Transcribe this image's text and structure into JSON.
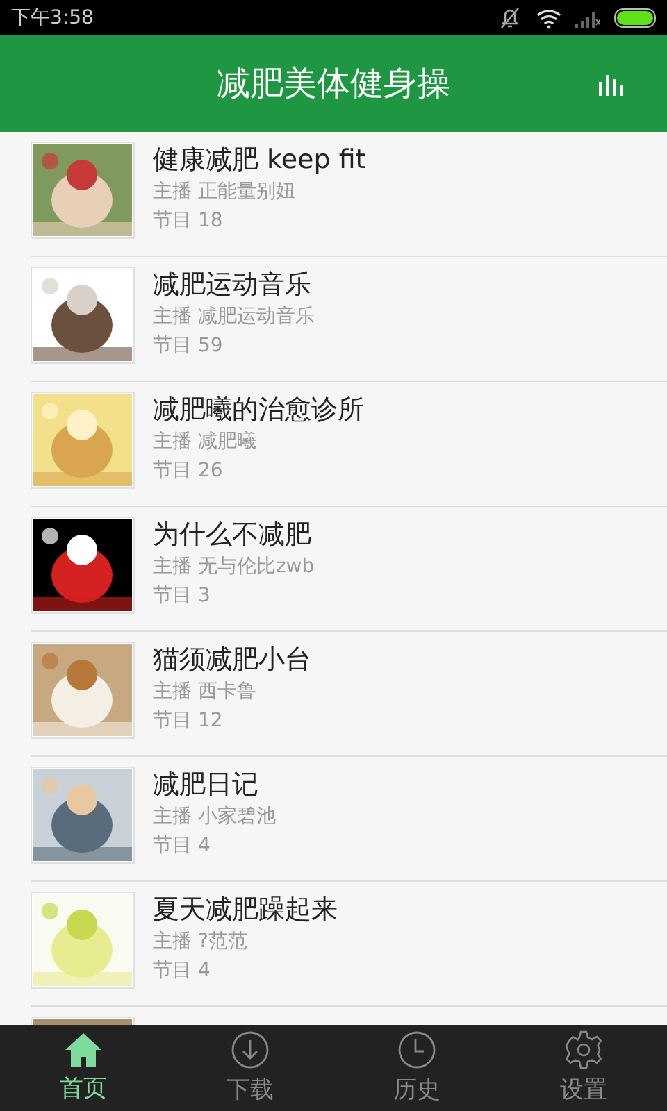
{
  "status_bar": {
    "time": "下午3:58"
  },
  "header": {
    "title": "减肥美体健身操"
  },
  "programs": [
    {
      "kind": "program",
      "title": "健康减肥 keep fit",
      "host": "主播 正能量别妞",
      "episodes": "节目 18"
    },
    {
      "kind": "program",
      "title": "减肥运动音乐",
      "host": "主播 减肥运动音乐",
      "episodes": "节目 59"
    },
    {
      "kind": "program",
      "title": "减肥曦的治愈诊所",
      "host": "主播 减肥曦",
      "episodes": "节目 26"
    },
    {
      "kind": "program",
      "title": "为什么不减肥",
      "host": "主播 无与伦比zwb",
      "episodes": "节目 3"
    },
    {
      "kind": "program",
      "title": "猫须减肥小台",
      "host": "主播 西卡鲁",
      "episodes": "节目 12"
    },
    {
      "kind": "program",
      "title": "减肥日记",
      "host": "主播  小家碧池",
      "episodes": "节目 4"
    },
    {
      "kind": "program",
      "title": "夏天减肥躁起来",
      "host": "主播 ?范范",
      "episodes": "节目 4"
    },
    {
      "kind": "picture"
    }
  ],
  "tabs": [
    {
      "label": "首页",
      "selected": true
    },
    {
      "label": "下载",
      "selected": false
    },
    {
      "label": "历史",
      "selected": false
    },
    {
      "label": "设置",
      "selected": false
    }
  ]
}
